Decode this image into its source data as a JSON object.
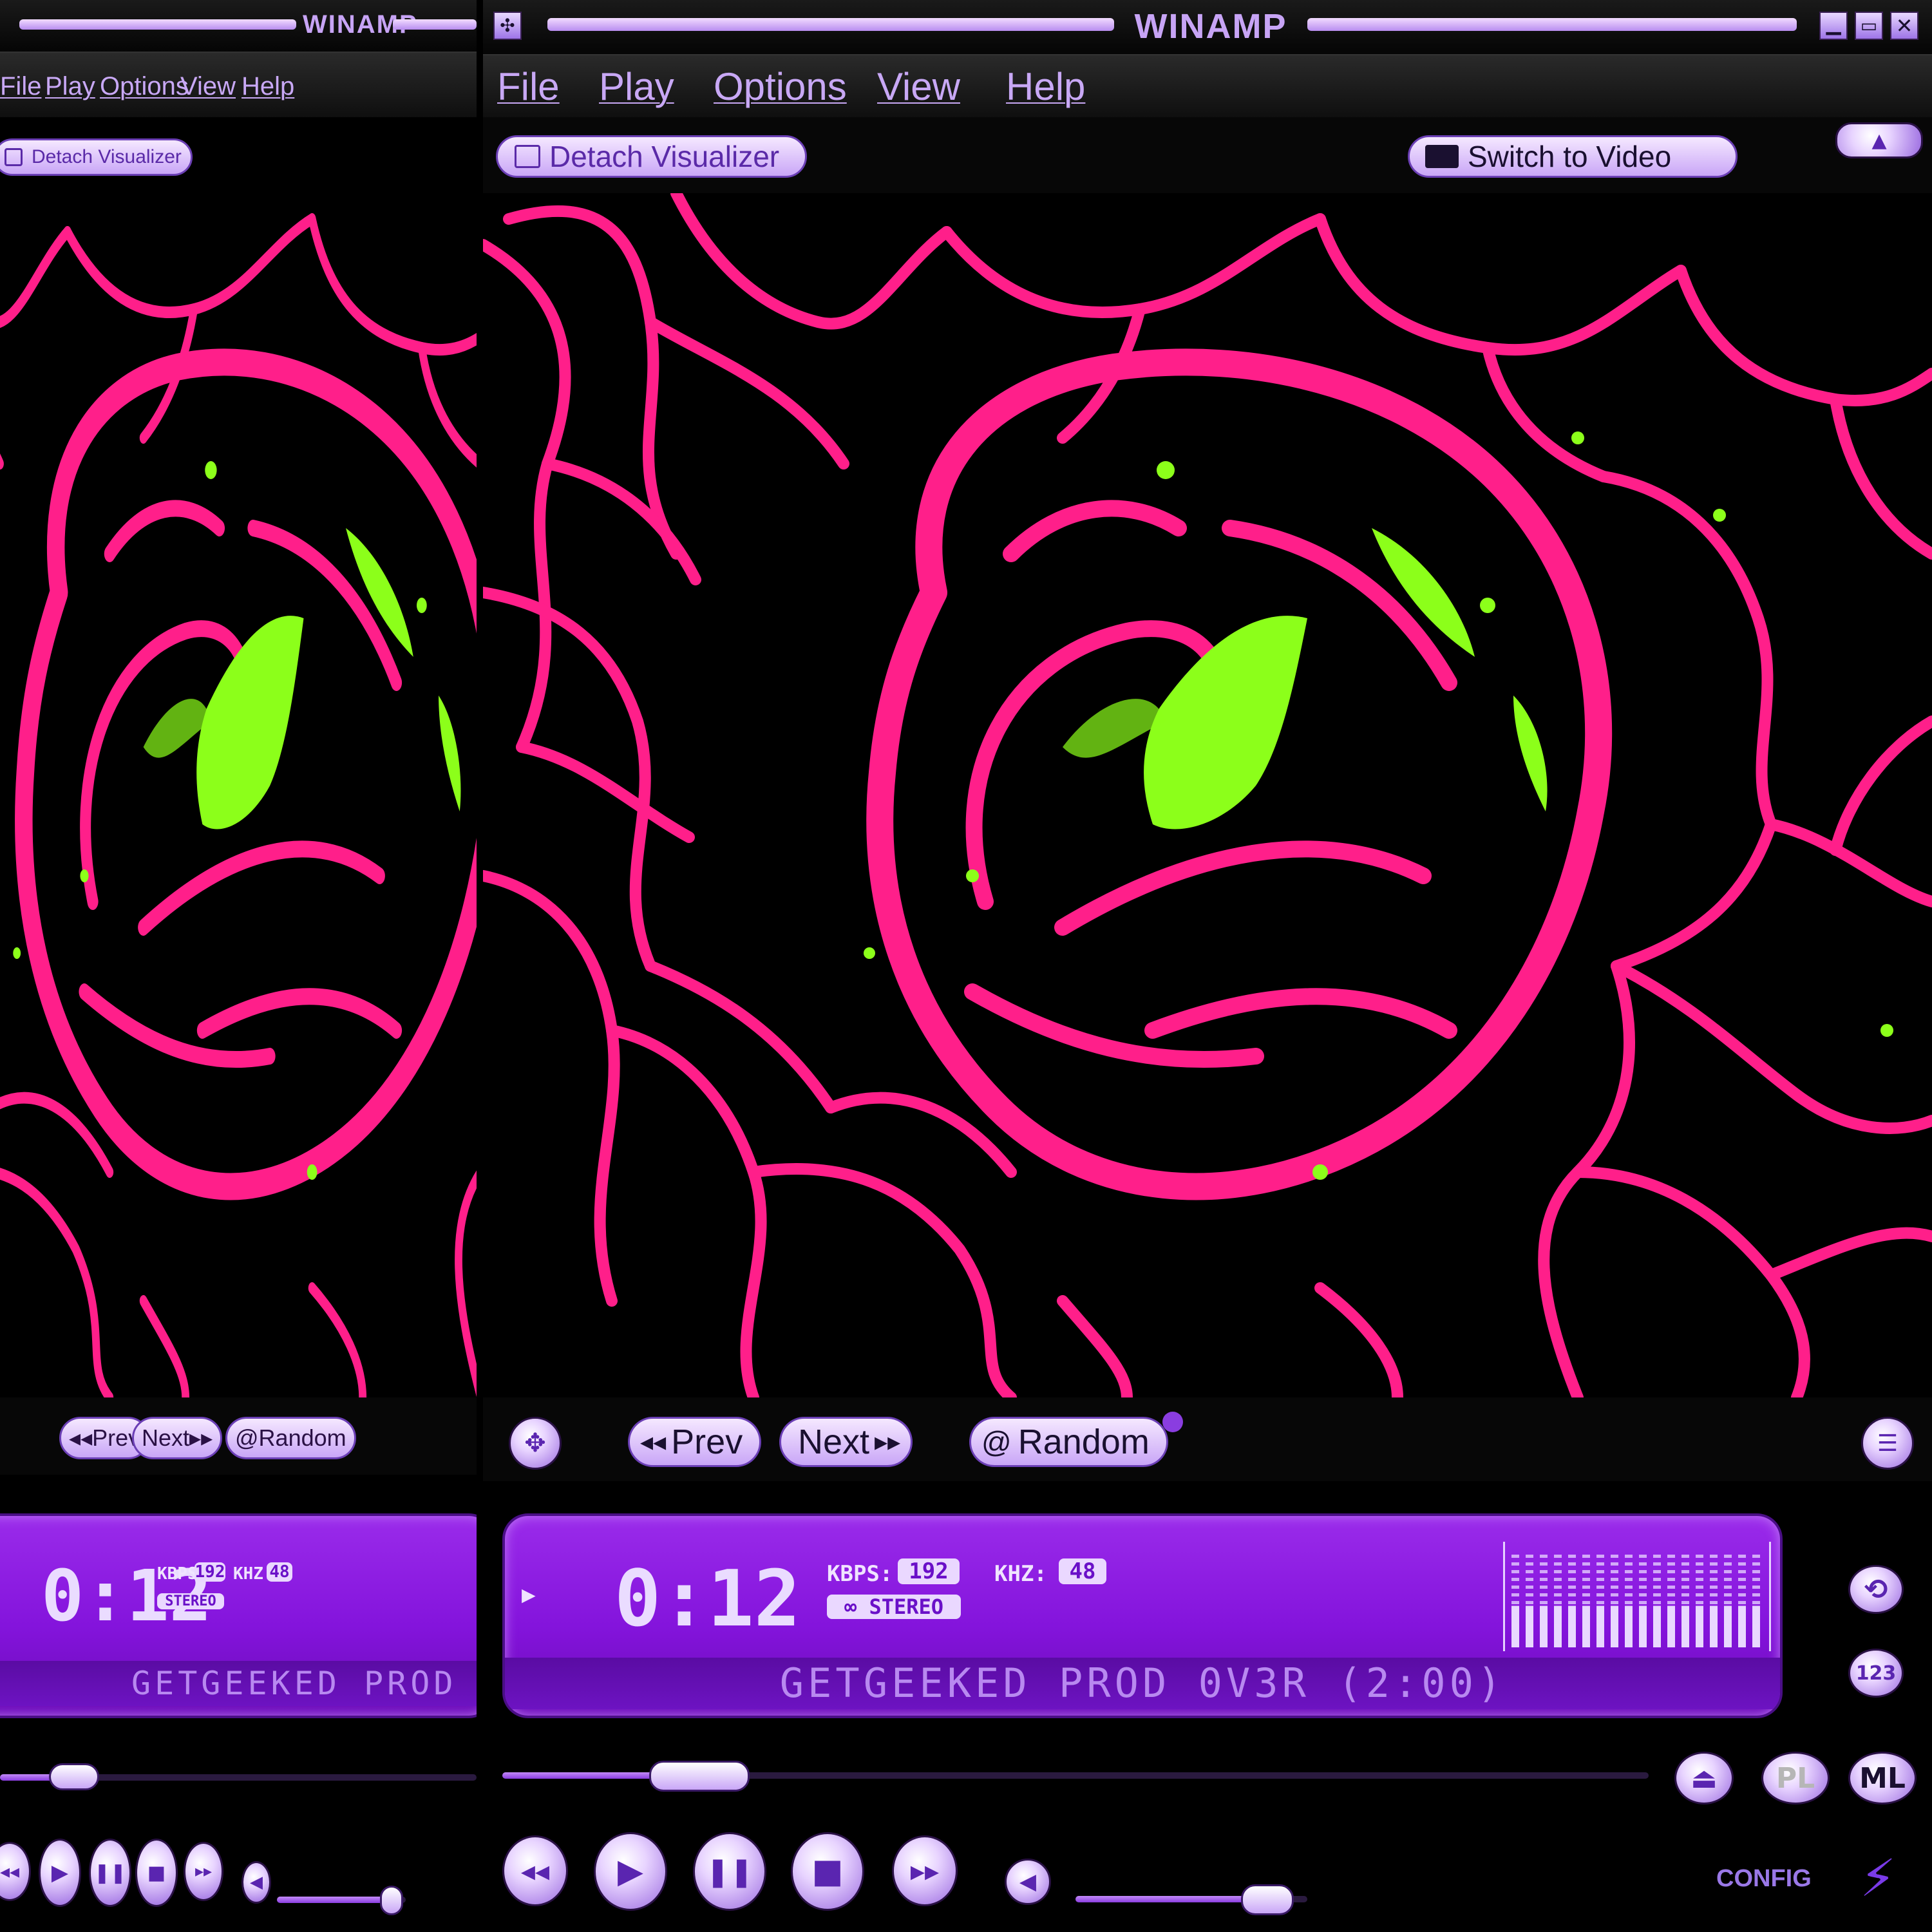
{
  "window": {
    "title": "WINAMP",
    "menu": [
      "File",
      "Play",
      "Options",
      "View",
      "Help"
    ]
  },
  "toolbar": {
    "detach_label": "Detach Visualizer",
    "switch_label": "Switch to Video"
  },
  "nav": {
    "prev_label": "Prev",
    "next_label": "Next",
    "random_label": "Random"
  },
  "display": {
    "time": "0:12",
    "kbps_label": "KBPS:",
    "kbps": "192",
    "khz_label": "KHZ:",
    "khz": "48",
    "stereo": "STEREO",
    "track": "GETGEEKED PROD 0V3R (2:00)",
    "seek_fraction": 0.17,
    "volume_fraction": 0.82
  },
  "side_buttons": {
    "pl": "PL",
    "ml": "ML"
  },
  "footer": {
    "config": "CONFIG"
  },
  "colors": {
    "accent": "#8414dc",
    "viz_pink": "#ff1f8a",
    "viz_green": "#8cff1a",
    "button_light": "#e9d8ff"
  },
  "icons": [
    "menu-icon",
    "minimize-icon",
    "maximize-icon",
    "close-icon",
    "detach-icon",
    "switch-video-icon",
    "move-icon",
    "rewind-icon",
    "forward-icon",
    "random-icon",
    "playlist-menu-icon",
    "play-indicator-icon",
    "repeat-icon",
    "shuffle-123-icon",
    "eject-icon",
    "play-icon",
    "pause-icon",
    "stop-icon",
    "volume-icon",
    "bolt-icon"
  ]
}
